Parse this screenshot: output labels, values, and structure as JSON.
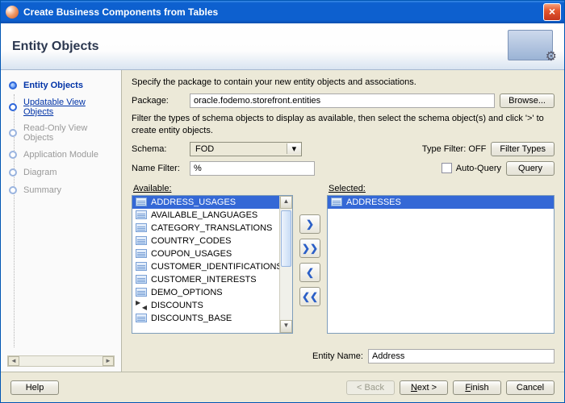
{
  "window_title": "Create Business Components from Tables",
  "header_title": "Entity Objects",
  "steps": [
    {
      "label": "Entity Objects",
      "state": "active"
    },
    {
      "label": "Updatable View Objects",
      "state": "link"
    },
    {
      "label": "Read-Only View Objects",
      "state": "disabled"
    },
    {
      "label": "Application Module",
      "state": "disabled"
    },
    {
      "label": "Diagram",
      "state": "disabled"
    },
    {
      "label": "Summary",
      "state": "disabled"
    }
  ],
  "instructions1": "Specify the package to contain your new entity objects and associations.",
  "labels": {
    "package": "Package:",
    "browse": "Browse...",
    "schema": "Schema:",
    "type_filter_status": "Type Filter: OFF",
    "filter_types": "Filter Types",
    "name_filter": "Name Filter:",
    "auto_query": "Auto-Query",
    "query": "Query",
    "available": "Available:",
    "selected": "Selected:",
    "entity_name": "Entity Name:"
  },
  "package_value": "oracle.fodemo.storefront.entities",
  "instructions2": "Filter the types of schema objects to display as available, then select the schema object(s) and click '>' to create entity objects.",
  "schema_value": "FOD",
  "name_filter_value": "%",
  "available_items": [
    {
      "label": "ADDRESS_USAGES",
      "selected": true,
      "icon": "table"
    },
    {
      "label": "AVAILABLE_LANGUAGES",
      "icon": "table"
    },
    {
      "label": "CATEGORY_TRANSLATIONS",
      "icon": "table"
    },
    {
      "label": "COUNTRY_CODES",
      "icon": "table"
    },
    {
      "label": "COUPON_USAGES",
      "icon": "table"
    },
    {
      "label": "CUSTOMER_IDENTIFICATIONS",
      "icon": "table"
    },
    {
      "label": "CUSTOMER_INTERESTS",
      "icon": "table"
    },
    {
      "label": "DEMO_OPTIONS",
      "icon": "table"
    },
    {
      "label": "DISCOUNTS",
      "icon": "discount"
    },
    {
      "label": "DISCOUNTS_BASE",
      "icon": "table"
    }
  ],
  "selected_items": [
    {
      "label": "ADDRESSES",
      "selected": true,
      "icon": "table"
    }
  ],
  "entity_name_value": "Address",
  "footer": {
    "help": "Help",
    "back": "< Back",
    "next": "Next >",
    "finish": "Finish",
    "cancel": "Cancel"
  },
  "shuttle": {
    "add": "❯",
    "add_all": "❯❯",
    "remove": "❮",
    "remove_all": "❮❮"
  }
}
